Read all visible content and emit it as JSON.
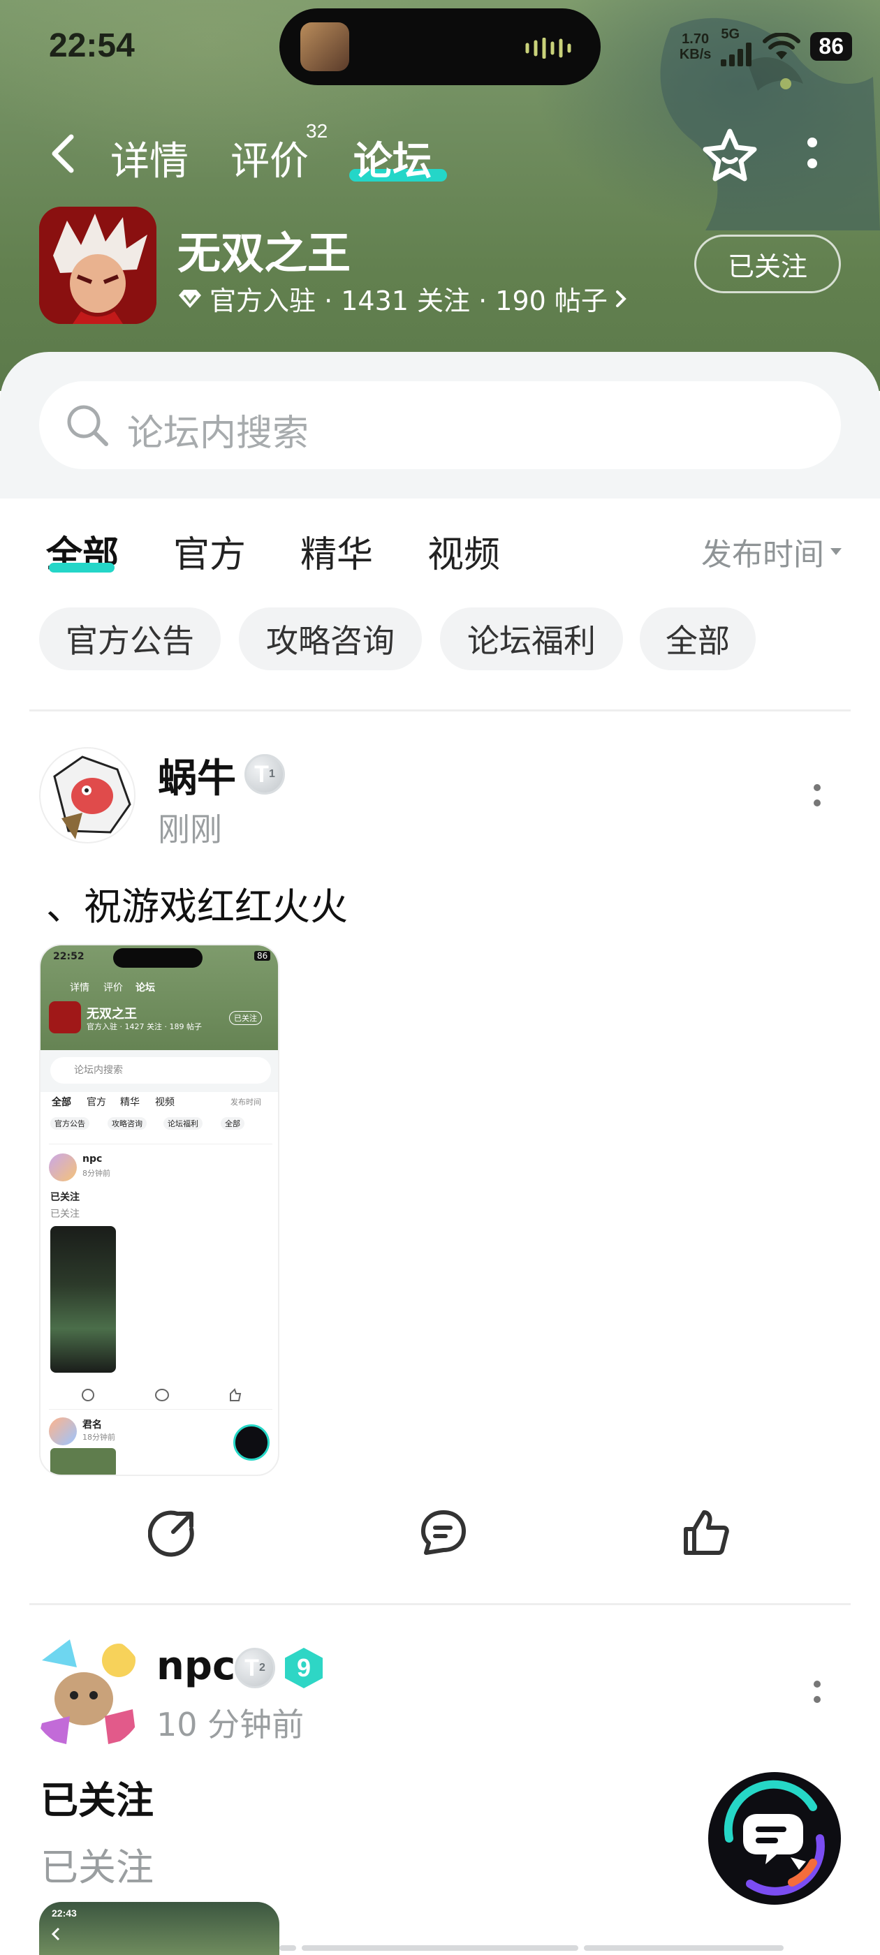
{
  "status": {
    "time": "22:54",
    "net_speed_top": "1.70",
    "net_speed_bottom": "KB/s",
    "signal": "5G",
    "battery": "86"
  },
  "nav": {
    "tabs": [
      {
        "label": "详情"
      },
      {
        "label": "评价",
        "count": "32"
      },
      {
        "label": "论坛"
      }
    ]
  },
  "game": {
    "title": "无双之王",
    "meta": "官方入驻 · 1431 关注 · 190 帖子",
    "follow_label": "已关注"
  },
  "search": {
    "placeholder": "论坛内搜索"
  },
  "filter": {
    "tabs": [
      "全部",
      "官方",
      "精华",
      "视频"
    ],
    "sort_label": "发布时间",
    "chips": [
      "官方公告",
      "攻略咨询",
      "论坛福利",
      "全部"
    ]
  },
  "posts": [
    {
      "username": "蜗牛",
      "badge": "T",
      "badge_sub": "1",
      "time": "刚刚",
      "text": "、祝游戏红红火火",
      "screenshot": {
        "time": "22:52",
        "battery": "86",
        "tabs": [
          "详情",
          "评价",
          "论坛"
        ],
        "game_title": "无双之王",
        "game_meta": "官方入驻 · 1427 关注 · 189 帖子",
        "follow": "已关注",
        "search": "论坛内搜索",
        "filter_tabs": [
          "全部",
          "官方",
          "精华",
          "视频"
        ],
        "sort": "发布时间",
        "chips": [
          "官方公告",
          "攻略咨询",
          "论坛福利",
          "全部"
        ],
        "post_user": "npc",
        "post_time": "8分钟前",
        "post_title": "已关注",
        "post_sub": "已关注",
        "post2_user": "君名",
        "post2_time": "18分钟前"
      }
    },
    {
      "username": "npc",
      "badge": "T",
      "badge_sub": "2",
      "level": "9",
      "time": "10 分钟前",
      "title": "已关注",
      "subtitle": "已关注",
      "screenshot_time": "22:43"
    }
  ],
  "colors": {
    "accent": "#24d6c8",
    "header_green": "#6f8c5e"
  }
}
